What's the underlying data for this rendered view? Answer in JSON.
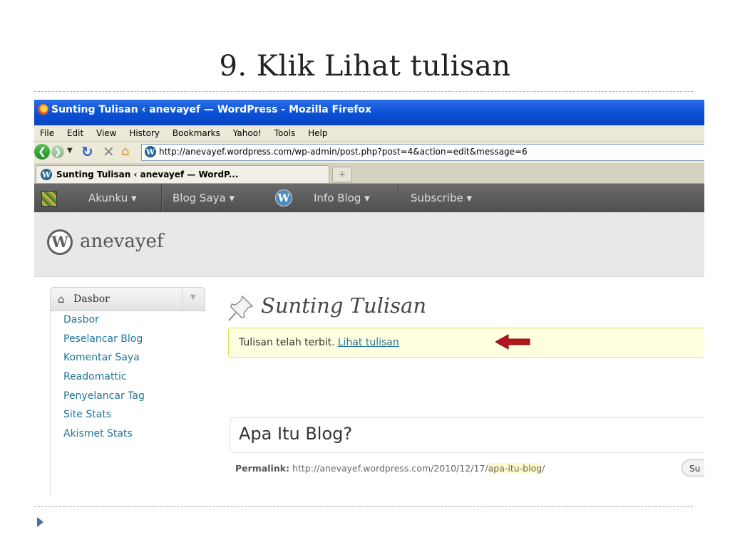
{
  "slide": {
    "title": "9. Klik Lihat tulisan"
  },
  "window": {
    "title": "Sunting Tulisan ‹ anevayef — WordPress - Mozilla Firefox"
  },
  "menubar": [
    "File",
    "Edit",
    "View",
    "History",
    "Bookmarks",
    "Yahoo!",
    "Tools",
    "Help"
  ],
  "url": "http://anevayef.wordpress.com/wp-admin/post.php?post=4&action=edit&message=6",
  "tab": {
    "label": "Sunting Tulisan ‹ anevayef — WordP...",
    "new_tab": "+"
  },
  "adminbar": {
    "items": [
      "Akunku ▾",
      "Blog Saya ▾",
      "Info Blog ▾",
      "Subscribe ▾"
    ],
    "wp_glyph": "W"
  },
  "site": {
    "name": "anevayef"
  },
  "sidebar": {
    "head": "Dasbor",
    "items": [
      "Dasbor",
      "Peselancar Blog",
      "Komentar Saya",
      "Readomattic",
      "Penyelancar Tag",
      "Site Stats",
      "Akismet Stats"
    ]
  },
  "main": {
    "page_title": "Sunting Tulisan",
    "notice_text": "Tulisan telah terbit.",
    "notice_link": "Lihat tulisan",
    "post_title": "Apa Itu Blog?",
    "permalink_label": "Permalink:",
    "permalink_base": "http://anevayef.wordpress.com/2010/12/17/",
    "permalink_slug": "apa-itu-blog",
    "permalink_tail": "/",
    "edit_button": "Su"
  },
  "colors": {
    "link": "#21759b",
    "arrow": "#b5161e",
    "titlebar": "#0a4fd4"
  }
}
